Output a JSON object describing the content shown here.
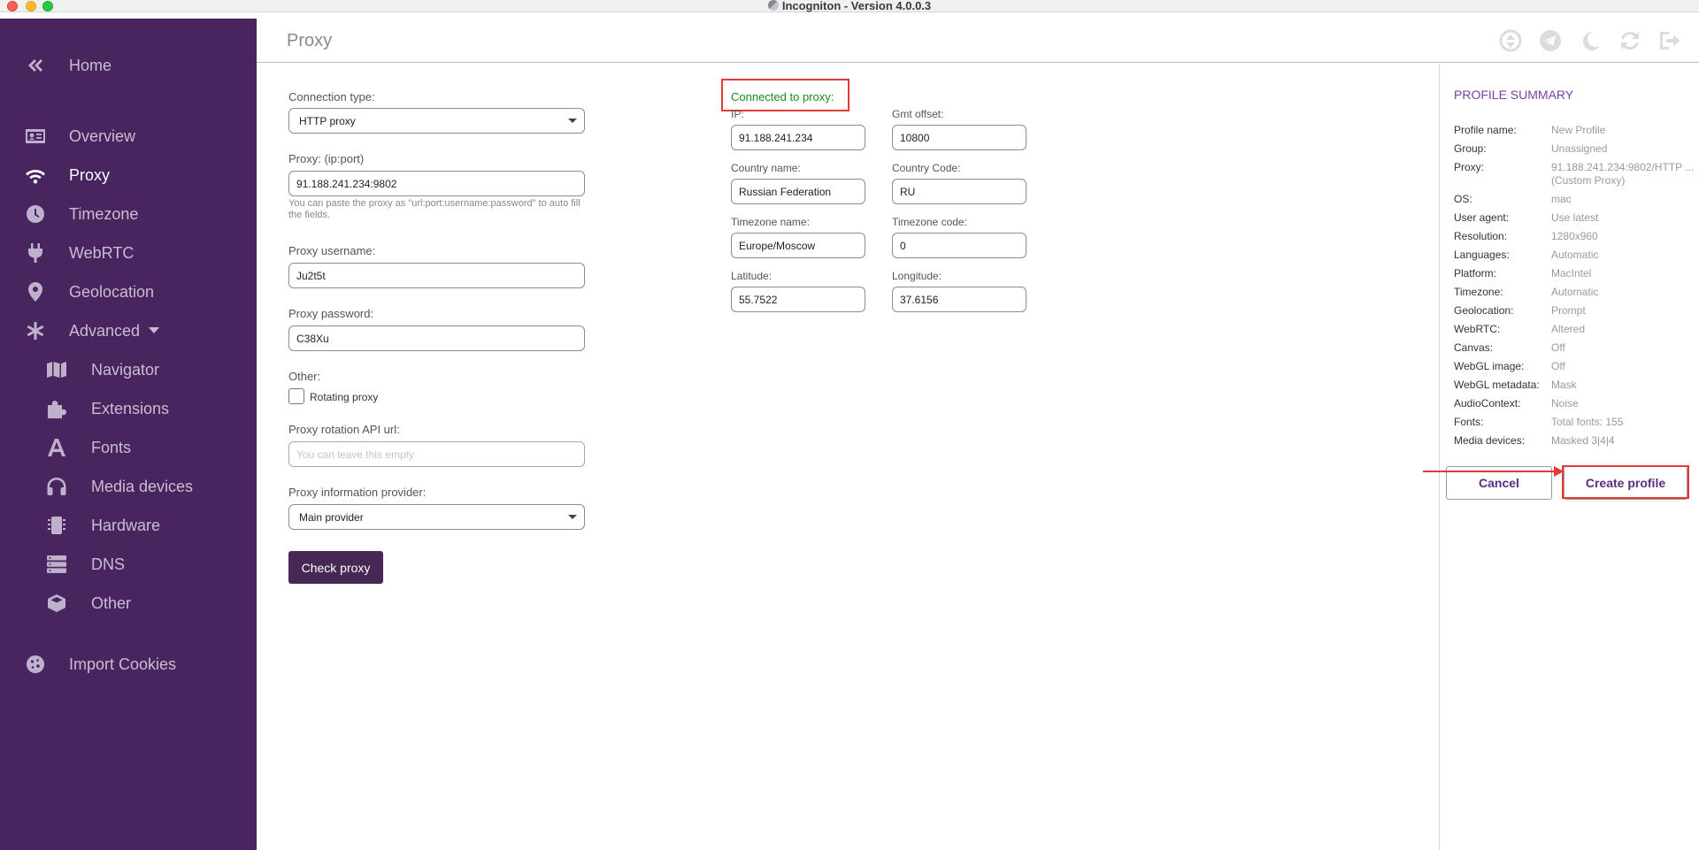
{
  "window": {
    "title": "Incogniton - Version 4.0.0.3"
  },
  "sidebar": {
    "items": [
      {
        "label": "Home"
      },
      {
        "label": "Overview"
      },
      {
        "label": "Proxy"
      },
      {
        "label": "Timezone"
      },
      {
        "label": "WebRTC"
      },
      {
        "label": "Geolocation"
      },
      {
        "label": "Advanced"
      },
      {
        "label": "Navigator"
      },
      {
        "label": "Extensions"
      },
      {
        "label": "Fonts"
      },
      {
        "label": "Media devices"
      },
      {
        "label": "Hardware"
      },
      {
        "label": "DNS"
      },
      {
        "label": "Other"
      },
      {
        "label": "Import Cookies"
      }
    ]
  },
  "header": {
    "title": "Proxy"
  },
  "form": {
    "connection_type": {
      "label": "Connection type:",
      "value": "HTTP proxy"
    },
    "proxy": {
      "label": "Proxy: (ip:port)",
      "value": "91.188.241.234:9802",
      "hint": "You can paste the proxy as \"url:port:username:password\" to auto fill the fields."
    },
    "username": {
      "label": "Proxy username:",
      "value": "Ju2t5t"
    },
    "password": {
      "label": "Proxy password:",
      "value": "C38Xu"
    },
    "other": {
      "label": "Other:",
      "rotating_label": "Rotating proxy"
    },
    "rotation_api": {
      "label": "Proxy rotation API url:",
      "placeholder": "You can leave this empty"
    },
    "info_provider": {
      "label": "Proxy information provider:",
      "value": "Main provider"
    },
    "check_button": "Check proxy"
  },
  "connection": {
    "status": "Connected to proxy:",
    "ip": {
      "label": "IP:",
      "value": "91.188.241.234"
    },
    "gmt_offset": {
      "label": "Gmt offset:",
      "value": "10800"
    },
    "country_name": {
      "label": "Country name:",
      "value": "Russian Federation"
    },
    "country_code": {
      "label": "Country Code:",
      "value": "RU"
    },
    "timezone_name": {
      "label": "Timezone name:",
      "value": "Europe/Moscow"
    },
    "timezone_code": {
      "label": "Timezone code:",
      "value": "0"
    },
    "latitude": {
      "label": "Latitude:",
      "value": "55.7522"
    },
    "longitude": {
      "label": "Longitude:",
      "value": "37.6156"
    }
  },
  "summary": {
    "title": "PROFILE SUMMARY",
    "rows": [
      {
        "key": "Profile name:",
        "value": "New Profile"
      },
      {
        "key": "Group:",
        "value": "Unassigned"
      },
      {
        "key": "Proxy:",
        "value": "91.188.241.234:9802/HTTP ...",
        "value2": "(Custom Proxy)"
      },
      {
        "key": "OS:",
        "value": "mac"
      },
      {
        "key": "User agent:",
        "value": "Use latest"
      },
      {
        "key": "Resolution:",
        "value": "1280x960"
      },
      {
        "key": "Languages:",
        "value": "Automatic"
      },
      {
        "key": "Platform:",
        "value": "MacIntel"
      },
      {
        "key": "Timezone:",
        "value": "Automatic"
      },
      {
        "key": "Geolocation:",
        "value": "Prompt"
      },
      {
        "key": "WebRTC:",
        "value": "Altered"
      },
      {
        "key": "Canvas:",
        "value": "Off"
      },
      {
        "key": "WebGL image:",
        "value": "Off"
      },
      {
        "key": "WebGL metadata:",
        "value": "Mask"
      },
      {
        "key": "AudioContext:",
        "value": "Noise"
      },
      {
        "key": "Fonts:",
        "value": "Total fonts: 155"
      },
      {
        "key": "Media devices:",
        "value": "Masked 3|4|4"
      }
    ],
    "cancel_button": "Cancel",
    "create_button": "Create profile"
  },
  "colors": {
    "sidebar_bg": "#48255f",
    "accent": "#472754",
    "status_ok": "#1d8a1d",
    "highlight": "#e53935"
  }
}
